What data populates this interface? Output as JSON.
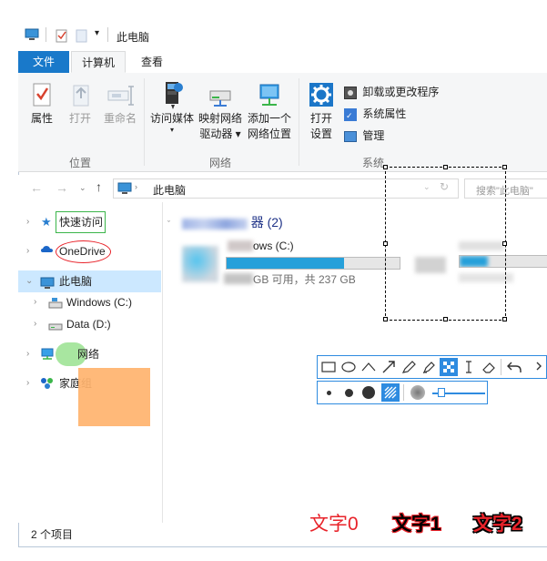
{
  "window": {
    "title": "此电脑",
    "qat_dropdown": "▾"
  },
  "tabs": {
    "file": "文件",
    "computer": "计算机",
    "view": "查看"
  },
  "ribbon": {
    "location_group": {
      "label": "位置",
      "properties": "属性",
      "open": "打开",
      "rename": "重命名"
    },
    "network_group": {
      "label": "网络",
      "access_media": "访问媒体",
      "map_drive_1": "映射网络",
      "map_drive_2": "驱动器 ▾",
      "add_location_1": "添加一个",
      "add_location_2": "网络位置"
    },
    "system_group": {
      "label": "系统",
      "open_settings_1": "打开",
      "open_settings_2": "设置",
      "uninstall": "卸载或更改程序",
      "system_properties": "系统属性",
      "manage": "管理"
    }
  },
  "address_bar": {
    "path": "此电脑",
    "search_placeholder": "搜索\"此电脑\""
  },
  "nav": {
    "quick_access": "快速访问",
    "onedrive": "OneDrive",
    "this_pc": "此电脑",
    "windows_c": "Windows (C:)",
    "data_d": "Data (D:)",
    "network": "网络",
    "homegroup": "家庭组"
  },
  "content": {
    "group_header_suffix": "器 (2)",
    "drive_c_name": "ows (C:)",
    "drive_c_usage": "GB 可用，共 237 GB",
    "drive_c_fill": 0.68,
    "drive_d_fill": 0.32
  },
  "status": {
    "items": "2 个项目"
  },
  "annotations": {
    "text0": "文字0",
    "text1": "文字1",
    "text2": "文字2",
    "colors": {
      "red": "#e8232a",
      "green": "#3bb54a",
      "orange": "#ffb36e",
      "accent": "#1979ca"
    }
  }
}
